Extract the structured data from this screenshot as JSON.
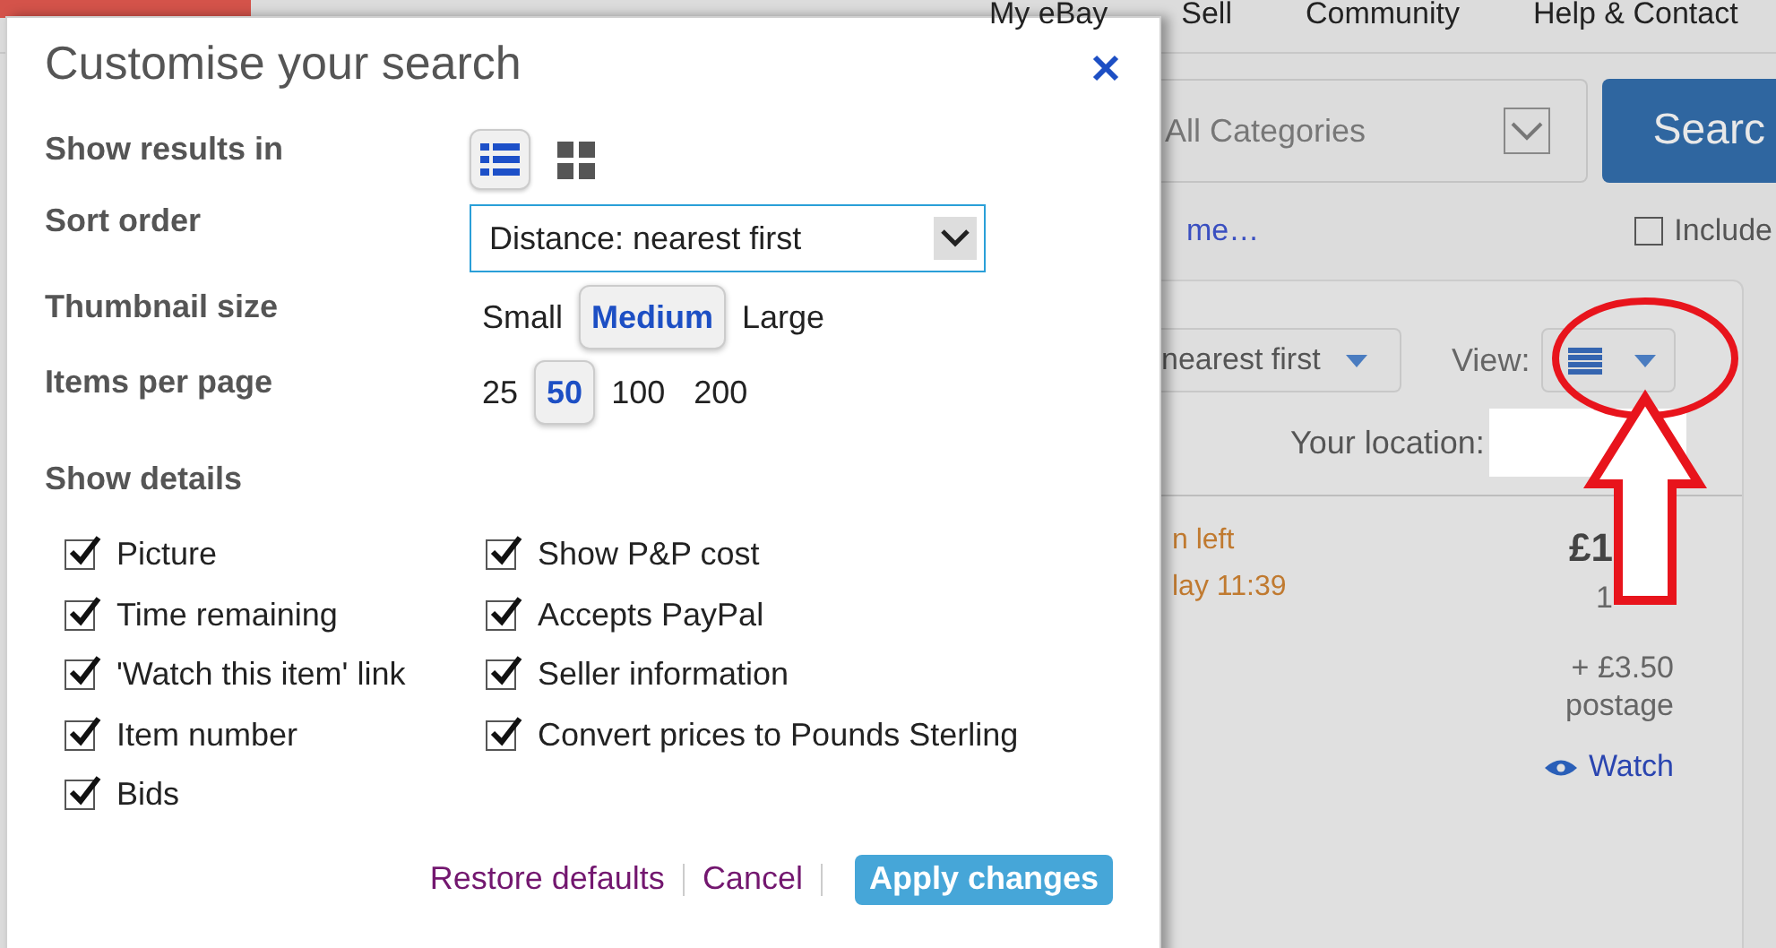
{
  "page_header": {
    "nav": [
      "My eBay",
      "Sell",
      "Community",
      "Help & Contact"
    ]
  },
  "search_bar": {
    "category": "All Categories",
    "button": "Searc"
  },
  "related_link": "me…",
  "include_option": {
    "label": "Include",
    "checked": false
  },
  "results": {
    "sort": "nearest first",
    "view_label": "View:",
    "location_label": "Your location:",
    "item": {
      "time_left": "n left",
      "end_time": "lay 11:39",
      "price": "£1",
      "price_line_2": "1",
      "postage_amount": "+ £3.50",
      "postage_label": "postage",
      "watch": "Watch"
    }
  },
  "dialog": {
    "title": "Customise your search",
    "settings": [
      {
        "label": "Show results in",
        "kind": "icons",
        "options": [
          {
            "kind": "list",
            "selected": true
          },
          {
            "kind": "grid",
            "selected": false
          }
        ]
      },
      {
        "label": "Sort order",
        "kind": "select",
        "value": "Distance: nearest first"
      },
      {
        "label": "Thumbnail size",
        "kind": "segmented",
        "options": [
          {
            "label": "Small",
            "selected": false
          },
          {
            "label": "Medium",
            "selected": true
          },
          {
            "label": "Large",
            "selected": false
          }
        ]
      },
      {
        "label": "Items per page",
        "kind": "segmented",
        "options": [
          {
            "label": "25",
            "selected": false
          },
          {
            "label": "50",
            "selected": true
          },
          {
            "label": "100",
            "selected": false
          },
          {
            "label": "200",
            "selected": false
          }
        ]
      }
    ],
    "details_heading": "Show details",
    "detail_columns": [
      [
        {
          "label": "Picture",
          "checked": true
        },
        {
          "label": "Time remaining",
          "checked": true
        },
        {
          "label": "'Watch this item' link",
          "checked": true
        },
        {
          "label": "Item number",
          "checked": true
        },
        {
          "label": "Bids",
          "checked": true
        }
      ],
      [
        {
          "label": "Show P&P cost",
          "checked": true
        },
        {
          "label": "Accepts PayPal",
          "checked": true
        },
        {
          "label": "Seller information",
          "checked": true
        },
        {
          "label": "Convert prices to Pounds Sterling",
          "checked": true
        }
      ]
    ],
    "footer": {
      "restore": "Restore defaults",
      "cancel": "Cancel",
      "apply": "Apply changes"
    }
  }
}
